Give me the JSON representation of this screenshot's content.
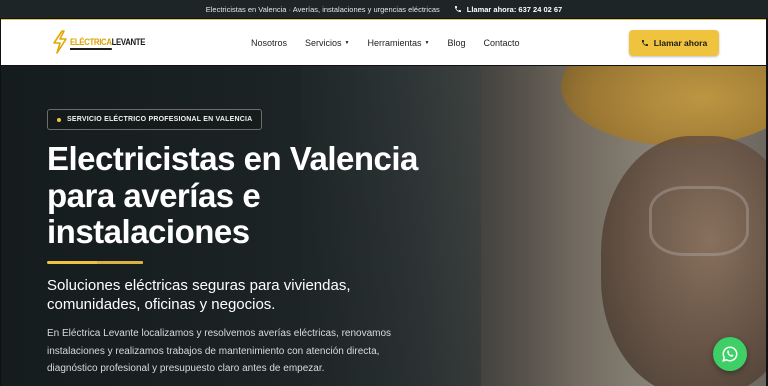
{
  "topbar": {
    "tagline": "Electricistas en Valencia · Averías, instalaciones y urgencias eléctricas",
    "phone_label": "Llamar ahora: 637 24 02 67"
  },
  "header": {
    "logo_part1": "ELÉCTRICA",
    "logo_part2": "LEVANTE",
    "nav": [
      {
        "label": "Nosotros"
      },
      {
        "label": "Servicios",
        "dropdown": true
      },
      {
        "label": "Herramientas",
        "dropdown": true
      },
      {
        "label": "Blog"
      },
      {
        "label": "Contacto"
      }
    ],
    "cta_label": "Llamar ahora"
  },
  "hero": {
    "badge": "SERVICIO ELÉCTRICO PROFESIONAL EN VALENCIA",
    "title": "Electricistas en Valencia para averías e instalaciones",
    "subtitle": "Soluciones eléctricas seguras para viviendas, comunidades, oficinas y negocios.",
    "description": "En Eléctrica Levante localizamos y resolvemos averías eléctricas, renovamos instalaciones y realizamos trabajos de mantenimiento con atención directa, diagnóstico profesional y presupuesto claro antes de empezar."
  },
  "colors": {
    "accent": "#efc33d",
    "topbar_bg": "#1d2526",
    "whatsapp": "#3ecf66"
  },
  "icons": {
    "phone": "phone-icon",
    "logo": "lightning-bolt-icon",
    "whatsapp": "whatsapp-icon"
  }
}
